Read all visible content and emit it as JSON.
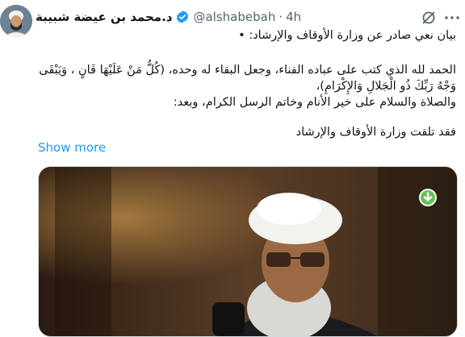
{
  "tweet": {
    "display_name": "د.محمد بن عيضة شبيبة",
    "handle": "@alshabebah",
    "separator": "·",
    "time": "4h",
    "lines": [
      "بيان نعي صادر عن وزارة الأوقاف والإرشاد: •",
      "الحمد لله الذي كتب على عباده الفناء، وجعل البقاء له وحده، (كُلُّ مَنْ عَلَيْهَا فَانٍ ، وَيَبْقَى",
      "وَجْهُ رَبِّكَ ذُو الْجَلالِ وَالإِكْرَامِ)،",
      "والصلاة والسلام على خير الأنام وخاتم الرسل الكرام، وبعد:",
      "فقد تلقت وزارة الأوقاف والإرشاد"
    ],
    "show_more": "Show more"
  },
  "icons": {
    "verified": "verified-badge-icon",
    "grok": "grok-icon",
    "more": "more-icon",
    "media_badge": "download-arrow-icon"
  },
  "colors": {
    "accent": "#1d9bf0",
    "muted": "#536471",
    "text": "#0f1419",
    "media_badge": "#6bbf59"
  }
}
